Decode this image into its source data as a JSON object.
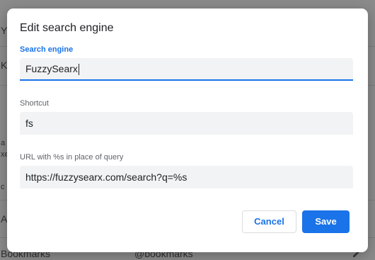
{
  "background": {
    "row_fragments": [
      "Y",
      "K",
      "a",
      "xe",
      "c",
      "A"
    ],
    "bottom_row": {
      "name": "Bookmarks",
      "shortcut": "@bookmarks"
    }
  },
  "dialog": {
    "title": "Edit search engine",
    "fields": [
      {
        "label": "Search engine",
        "value": "FuzzySearx",
        "focused": true
      },
      {
        "label": "Shortcut",
        "value": "fs",
        "focused": false
      },
      {
        "label": "URL with %s in place of query",
        "value": "https://fuzzysearx.com/search?q=%s",
        "focused": false
      }
    ],
    "cancel_label": "Cancel",
    "save_label": "Save"
  },
  "colors": {
    "accent": "#1a73e8",
    "field_bg": "#f1f3f4",
    "label_gray": "#5f6368",
    "title_text": "#202124"
  },
  "icons": {
    "background_edit": "pencil-icon"
  }
}
